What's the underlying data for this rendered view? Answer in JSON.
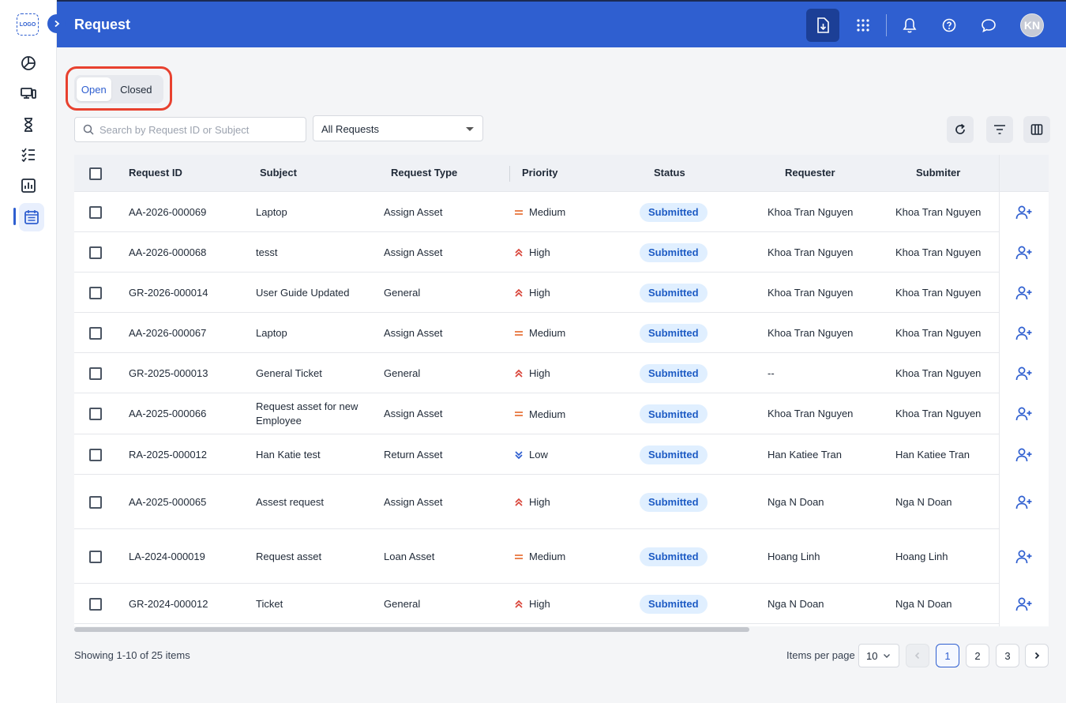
{
  "app": {
    "logo_text": "LOGO",
    "page_title": "Request",
    "avatar_initials": "KN",
    "accent_color": "#2f5fd0"
  },
  "sidebar": {
    "items": [
      {
        "name": "dashboard",
        "icon": "pie-chart-icon",
        "active": false
      },
      {
        "name": "devices",
        "icon": "devices-icon",
        "active": false
      },
      {
        "name": "pending",
        "icon": "hourglass-icon",
        "active": false
      },
      {
        "name": "tasks",
        "icon": "checklist-icon",
        "active": false
      },
      {
        "name": "reports",
        "icon": "bar-chart-icon",
        "active": false
      },
      {
        "name": "requests",
        "icon": "calendar-list-icon",
        "active": true
      }
    ]
  },
  "header": {
    "icons": [
      "download-doc-icon",
      "apps-grid-icon",
      "bell-icon",
      "help-icon",
      "chat-icon"
    ]
  },
  "tabs": [
    {
      "label": "Open",
      "active": true
    },
    {
      "label": "Closed",
      "active": false
    }
  ],
  "filters": {
    "search_placeholder": "Search by Request ID or Subject",
    "search_value": "",
    "request_filter": "All Requests"
  },
  "table": {
    "columns": [
      "Request ID",
      "Subject",
      "Request Type",
      "Priority",
      "Status",
      "Requester",
      "Submiter"
    ],
    "rows": [
      {
        "id": "AA-2026-000069",
        "subject": "Laptop",
        "type": "Assign Asset",
        "priority": "Medium",
        "status": "Submitted",
        "requester": "Khoa Tran Nguyen",
        "submitter": "Khoa Tran Nguyen"
      },
      {
        "id": "AA-2026-000068",
        "subject": "tesst",
        "type": "Assign Asset",
        "priority": "High",
        "status": "Submitted",
        "requester": "Khoa Tran Nguyen",
        "submitter": "Khoa Tran Nguyen"
      },
      {
        "id": "GR-2026-000014",
        "subject": "User Guide Updated",
        "type": "General",
        "priority": "High",
        "status": "Submitted",
        "requester": "Khoa Tran Nguyen",
        "submitter": "Khoa Tran Nguyen"
      },
      {
        "id": "AA-2026-000067",
        "subject": "Laptop",
        "type": "Assign Asset",
        "priority": "Medium",
        "status": "Submitted",
        "requester": "Khoa Tran Nguyen",
        "submitter": "Khoa Tran Nguyen"
      },
      {
        "id": "GR-2025-000013",
        "subject": "General Ticket",
        "type": "General",
        "priority": "High",
        "status": "Submitted",
        "requester": "--",
        "submitter": "Khoa Tran Nguyen"
      },
      {
        "id": "AA-2025-000066",
        "subject": "Request asset for new Employee",
        "type": "Assign Asset",
        "priority": "Medium",
        "status": "Submitted",
        "requester": "Khoa Tran Nguyen",
        "submitter": "Khoa Tran Nguyen"
      },
      {
        "id": "RA-2025-000012",
        "subject": "Han Katie test",
        "type": "Return Asset",
        "priority": "Low",
        "status": "Submitted",
        "requester": "Han Katiee Tran",
        "submitter": "Han Katiee Tran"
      },
      {
        "id": "AA-2025-000065",
        "subject": "Assest request",
        "type": "Assign Asset",
        "priority": "High",
        "status": "Submitted",
        "requester": "Nga N Doan",
        "submitter": "Nga N Doan"
      },
      {
        "id": "LA-2024-000019",
        "subject": "Request asset",
        "type": "Loan Asset",
        "priority": "Medium",
        "status": "Submitted",
        "requester": "Hoang Linh",
        "submitter": "Hoang Linh"
      },
      {
        "id": "GR-2024-000012",
        "subject": "Ticket",
        "type": "General",
        "priority": "High",
        "status": "Submitted",
        "requester": "Nga N Doan",
        "submitter": "Nga N Doan"
      }
    ],
    "row_action_icon": "assign-user-icon",
    "priority_colors": {
      "High": "#d9453a",
      "Medium": "#e8743b",
      "Low": "#2f5fd0"
    },
    "status_badge": {
      "background": "#e0efff",
      "text": "#1d5bc4"
    }
  },
  "footer": {
    "showing": "Showing 1-10 of 25 items",
    "items_per_page_label": "Items per page",
    "items_per_page": "10",
    "pages": [
      "1",
      "2",
      "3"
    ],
    "current_page": "1"
  }
}
